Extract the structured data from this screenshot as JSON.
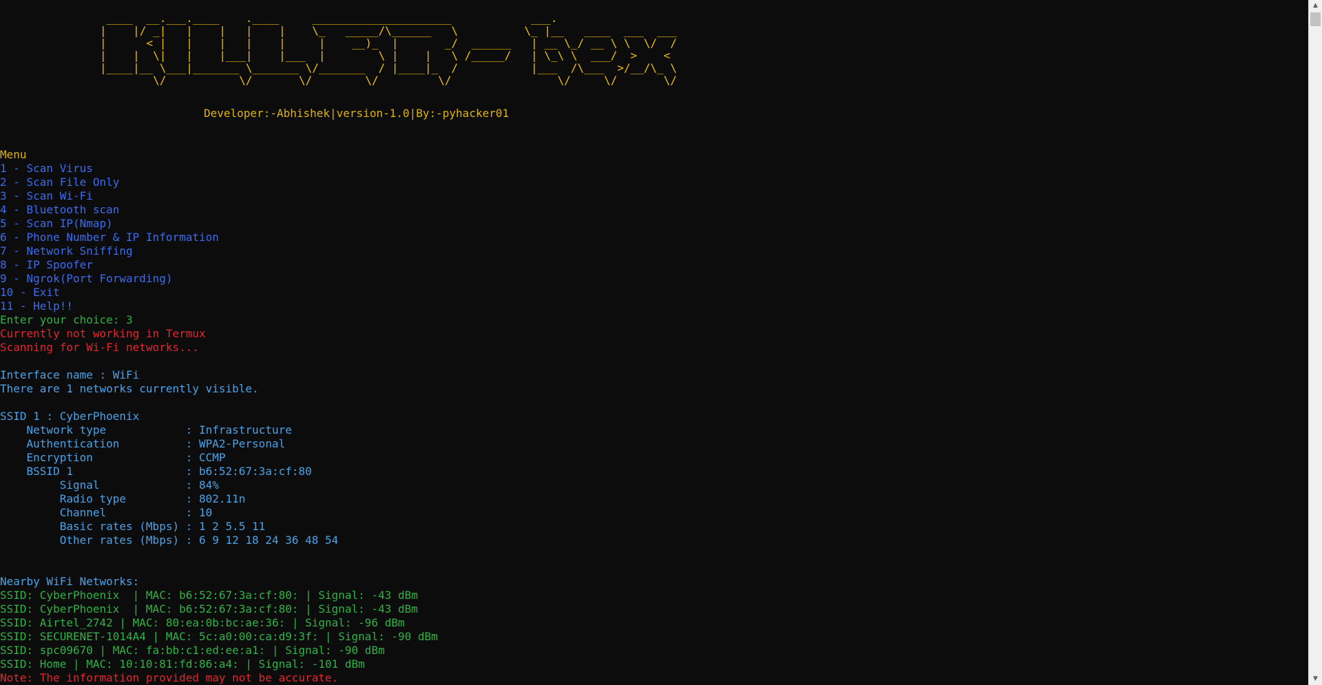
{
  "banner": {
    "ascii_art": " ____  __.___.____    .____     _____________________            ___.\n|    |/ _|   |    |   |    |    \\_   _____/\\______   \\          \\_ |__   ____  ___  ___\n|      < |   |    |   |    |     |    __)_  |       _/  ______   | __ \\_/ __ \\ \\  \\/  /\n|    |  \\|   |    |___|    |___  |        \\ |    |   \\ /_____/   | \\_\\ \\  ___/  >    <\n|____|__ \\___|_______ \\_______ \\/_______  / |____|_  /           |___  /\\___  >/__/\\_ \\\n        \\/           \\/       \\/        \\/         \\/                \\/     \\/       \\/",
    "credits": "Developer:-Abhishek|version-1.0|By:-pyhacker01"
  },
  "menu": {
    "heading": "Menu",
    "items": [
      "1 - Scan Virus",
      "2 - Scan File Only",
      "3 - Scan Wi-Fi",
      "4 - Bluetooth scan",
      "5 - Scan IP(Nmap)",
      "6 - Phone Number & IP Information",
      "7 - Network Sniffing",
      "8 - IP Spoofer",
      "9 - Ngrok(Port Forwarding)",
      "10 - Exit",
      "11 - Help!!"
    ],
    "prompt": "Enter your choice: 3"
  },
  "messages": {
    "termux_warning": "Currently not working in Termux",
    "scanning": "Scanning for Wi-Fi networks..."
  },
  "interface": {
    "name_line": "Interface name : WiFi",
    "visible_line": "There are 1 networks currently visible."
  },
  "network_detail": {
    "ssid_line": "SSID 1 : CyberPhoenix",
    "fields": [
      "    Network type            : Infrastructure",
      "    Authentication          : WPA2-Personal",
      "    Encryption              : CCMP",
      "    BSSID 1                 : b6:52:67:3a:cf:80",
      "         Signal             : 84%",
      "         Radio type         : 802.11n",
      "         Channel            : 10",
      "         Basic rates (Mbps) : 1 2 5.5 11",
      "         Other rates (Mbps) : 6 9 12 18 24 36 48 54"
    ]
  },
  "nearby": {
    "heading": "Nearby WiFi Networks:",
    "rows": [
      "SSID: CyberPhoenix  | MAC: b6:52:67:3a:cf:80: | Signal: -43 dBm",
      "SSID: CyberPhoenix  | MAC: b6:52:67:3a:cf:80: | Signal: -43 dBm",
      "SSID: Airtel_2742 | MAC: 80:ea:0b:bc:ae:36: | Signal: -96 dBm",
      "SSID: SECURENET-1014A4 | MAC: 5c:a0:00:ca:d9:3f: | Signal: -90 dBm",
      "SSID: spc09670 | MAC: fa:bb:c1:ed:ee:a1: | Signal: -90 dBm",
      "SSID: Home | MAC: 10:10:81:fd:86:a4: | Signal: -101 dBm"
    ],
    "note": "Note: The information provided may not be accurate."
  },
  "scrollbar": {
    "up_glyph": "▲",
    "down_glyph": "▼"
  },
  "colors": {
    "background": "#0c0c0c",
    "banner": "#f0c000",
    "menu": "#3b6cf0",
    "prompt": "#2fb344",
    "error": "#e3262c",
    "info": "#4aa3ea"
  }
}
